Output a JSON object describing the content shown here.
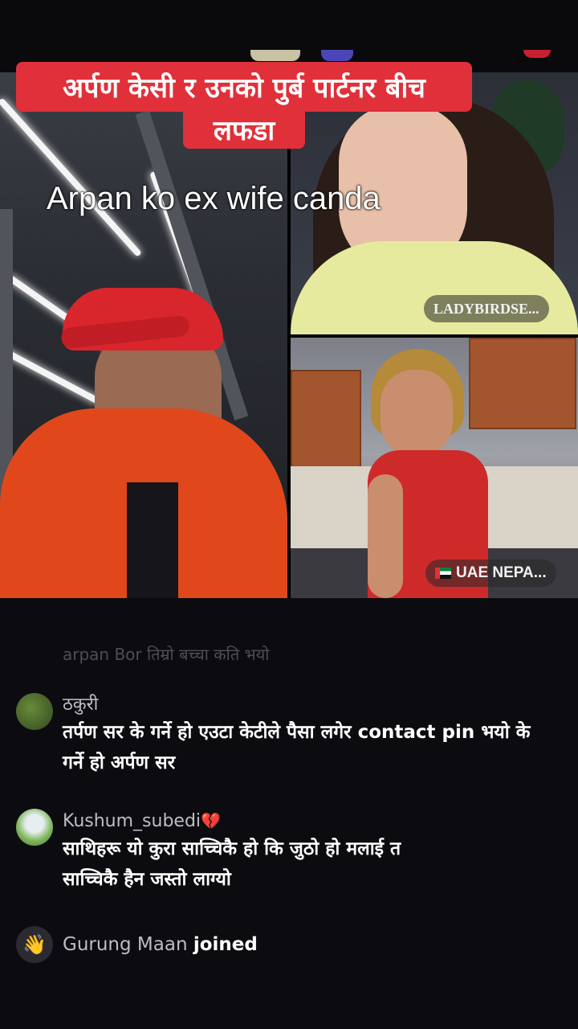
{
  "headline": {
    "line1": "अर्पण केसी र उनको पुर्ब पार्टनर बीच",
    "line2": "लफडा"
  },
  "subtitle": "Arpan ko ex wife canda",
  "video": {
    "participant_top_right": "LADYBIRDSE...",
    "participant_bottom_right": "UAE  NEPA..."
  },
  "faded_comment": "arpan Bor तिम्रो बच्चा कति भयो",
  "comments": [
    {
      "username": "ठकुरी",
      "text_line1": "तर्पण सर के गर्ने हो एउटा केटीले पैसा लगेर contact pin भयो के",
      "text_line2": "गर्ने हो अर्पण सर"
    },
    {
      "username": "Kushum_subedi",
      "badge": "💔",
      "text_line1": "साथिहरू याे कुरा साच्चिकै  हाे कि जुठाे हाे  मलाई  त",
      "text_line2": "साच्चिकै  हैन  जस्तो  लाग्याे"
    }
  ],
  "joined": {
    "name": "Gurung Maan",
    "word": "joined"
  },
  "icons": {
    "wave": "waving-hand-icon",
    "flag": "uae-flag-icon"
  },
  "colors": {
    "headline_bg": "#e0303a",
    "background": "#0c0c10",
    "username": "#bdbdc2"
  }
}
